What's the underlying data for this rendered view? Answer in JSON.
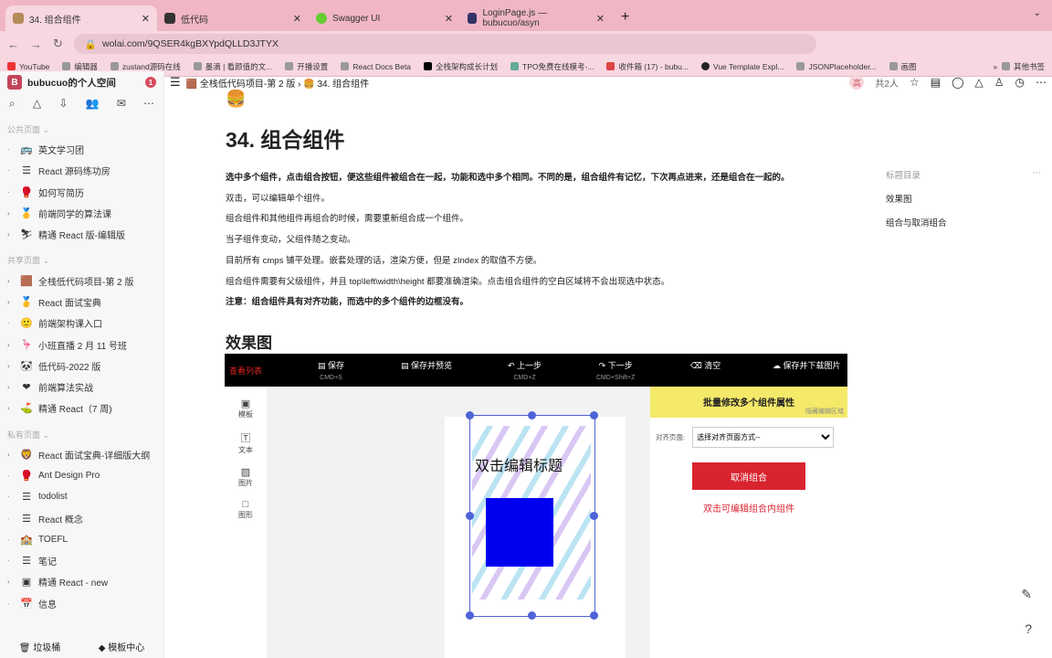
{
  "browser": {
    "tabs": [
      {
        "title": "34. 组合组件",
        "active": true
      },
      {
        "title": "低代码"
      },
      {
        "title": "Swagger UI"
      },
      {
        "title": "LoginPage.js — bubucuo/asyn"
      }
    ],
    "url": "wolai.com/9QSER4kgBXYpdQLLD3JTYX",
    "bookmarks": [
      "YouTube",
      "编辑器",
      "zustand源码在线",
      "墨滴 | 看颜值的文...",
      "开播设置",
      "React Docs Beta",
      "全栈架构成长计划",
      "TPO免费在线模考-...",
      "收件箱 (17) - bubu...",
      "Vue Template Expl...",
      "JSONPlaceholder...",
      "画图"
    ],
    "other_bookmarks": "其他书签"
  },
  "sidebar": {
    "space": "bubucuo的个人空间",
    "badge": "1",
    "sections": [
      {
        "title": "公共页面",
        "items": [
          {
            "e": "🚌",
            "c": "·",
            "l": "英文学习团"
          },
          {
            "e": "☰",
            "c": "·",
            "l": "React 源码练功房"
          },
          {
            "e": "🥊",
            "c": "·",
            "l": "如何写简历"
          },
          {
            "e": "🥇",
            "c": "›",
            "l": "前端同学的算法课"
          },
          {
            "e": "⛷",
            "c": "›",
            "l": "精通 React 版-编辑版"
          }
        ]
      },
      {
        "title": "共享页面",
        "items": [
          {
            "e": "🟫",
            "c": "›",
            "l": "全栈低代码项目-第 2 版"
          },
          {
            "e": "🥇",
            "c": "›",
            "l": "React 面试宝典"
          },
          {
            "e": "🙂",
            "c": "·",
            "l": "前端架构课入口"
          },
          {
            "e": "🦩",
            "c": "›",
            "l": "小班直播 2 月 11 号班"
          },
          {
            "e": "🐼",
            "c": "›",
            "l": "低代码-2022 版"
          },
          {
            "e": "❤",
            "c": "›",
            "l": "前端算法实战"
          },
          {
            "e": "⛳",
            "c": "›",
            "l": "精通 React（7 周)"
          }
        ]
      },
      {
        "title": "私有页面",
        "items": [
          {
            "e": "🦁",
            "c": "›",
            "l": "React 面试宝典-详细版大纲"
          },
          {
            "e": "🥊",
            "c": "·",
            "l": "Ant Design Pro"
          },
          {
            "e": "☰",
            "c": "·",
            "l": "todolist"
          },
          {
            "e": "☰",
            "c": "·",
            "l": "React 概念"
          },
          {
            "e": "🏫",
            "c": "·",
            "l": "TOEFL"
          },
          {
            "e": "☰",
            "c": "·",
            "l": "笔记"
          },
          {
            "e": "▣",
            "c": "›",
            "l": "精通 React - new"
          },
          {
            "e": "📅",
            "c": "·",
            "l": "信息"
          }
        ]
      }
    ],
    "trash": "垃圾桶",
    "templates": "模板中心"
  },
  "topbar": {
    "crumb1": "全栈低代码项目-第 2 版",
    "crumb2": "34. 组合组件",
    "avatar": "高",
    "members": "共2人"
  },
  "doc": {
    "title": "34. 组合组件",
    "paragraphs": [
      "选中多个组件，点击组合按钮，便这些组件被组合在一起，功能和选中多个相同。不同的是，组合组件有记忆，下次再点进来，还是组合在一起的。",
      "双击，可以编辑单个组件。",
      "组合组件和其他组件再组合的时候，需要重新组合成一个组件。",
      "当子组件变动，父组件随之变动。",
      "目前所有 cmps 铺平处理。嵌套处理的话，渲染方便，但是 zIndex 的取值不方便。",
      "组合组件需要有父级组件，并且 top\\left\\width\\height 都要准确渲染。点击组合组件的空白区域将不会出现选中状态。",
      "注意：组合组件具有对齐功能，而选中的多个组件的边框没有。"
    ],
    "h2": "效果图"
  },
  "toc": {
    "title": "标题目录",
    "items": [
      "效果图",
      "组合与取消组合"
    ]
  },
  "demo": {
    "list": "查看列表",
    "save": "保存",
    "save_k": "CMD+S",
    "preview": "保存并预览",
    "undo": "上一步",
    "undo_k": "CMD+Z",
    "redo": "下一步",
    "redo_k": "CMD+Shift+Z",
    "clear": "清空",
    "download": "保存并下载图片",
    "left": [
      "模板",
      "文本",
      "图片",
      "图形"
    ],
    "canvas_title": "双击编辑标题",
    "panel_title": "批量修改多个组件属性",
    "hide": "隐藏编辑区域",
    "align_label": "对齐页面:",
    "align_value": "选择对齐页面方式--",
    "ungroup": "取消组合",
    "hint": "双击可编辑组合内组件"
  }
}
